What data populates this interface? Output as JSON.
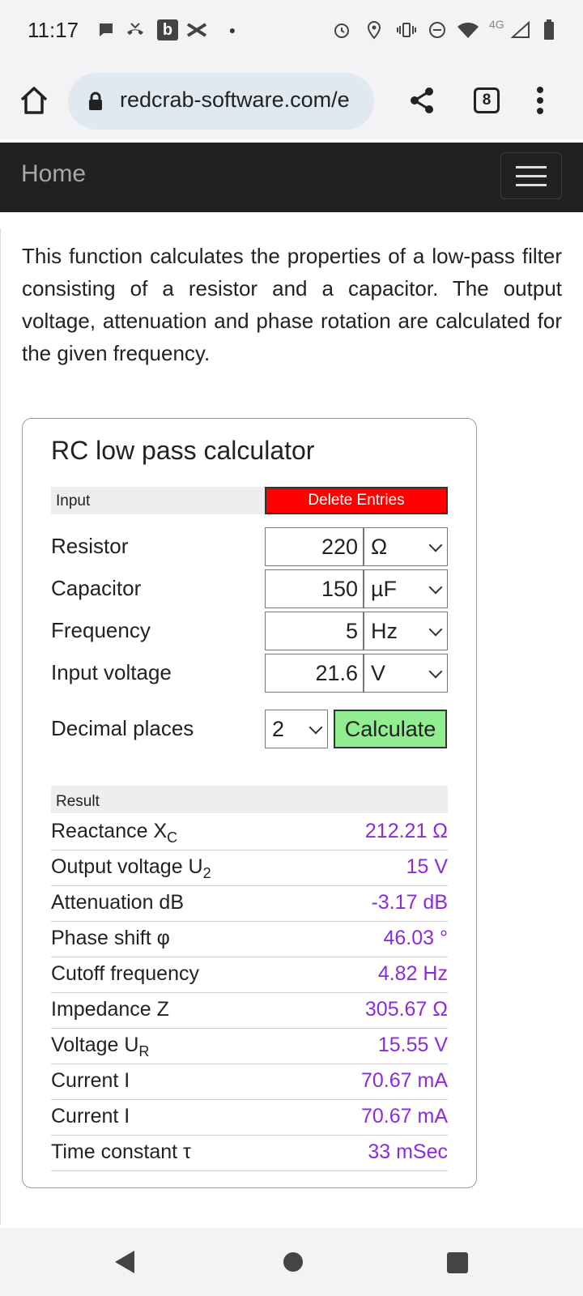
{
  "status_bar": {
    "time": "11:17",
    "network": "4G"
  },
  "browser": {
    "url": "redcrab-software.com/e",
    "tab_count": "8"
  },
  "navbar": {
    "home_label": "Home"
  },
  "intro_text": "This function calculates the properties of a low-pass filter consisting of a resistor and a capacitor. The output voltage, attenuation and phase rotation are calculated for the given frequency.",
  "calculator": {
    "title": "RC low pass calculator",
    "input_header": "Input",
    "delete_label": "Delete Entries",
    "inputs": [
      {
        "label": "Resistor",
        "value": "220",
        "unit": "Ω"
      },
      {
        "label": "Capacitor",
        "value": "150",
        "unit": "µF"
      },
      {
        "label": "Frequency",
        "value": "5",
        "unit": "Hz"
      },
      {
        "label": "Input voltage",
        "value": "21.6",
        "unit": "V"
      }
    ],
    "decimal_label": "Decimal places",
    "decimal_value": "2",
    "calculate_label": "Calculate",
    "result_header": "Result",
    "results": [
      {
        "label": "Reactance X",
        "sub": "C",
        "value": "212.21 Ω"
      },
      {
        "label": "Output voltage U",
        "sub": "2",
        "value": "15 V"
      },
      {
        "label": "Attenuation dB",
        "sub": "",
        "value": "-3.17 dB"
      },
      {
        "label": "Phase shift φ",
        "sub": "",
        "value": "46.03 °"
      },
      {
        "label": "Cutoff frequency",
        "sub": "",
        "value": "4.82 Hz"
      },
      {
        "label": "Impedance Z",
        "sub": "",
        "value": "305.67 Ω"
      },
      {
        "label": "Voltage U",
        "sub": "R",
        "value": "15.55 V"
      },
      {
        "label": "Current I",
        "sub": "",
        "value": "70.67 mA"
      },
      {
        "label": "Current I",
        "sub": "",
        "value": "70.67 mA"
      },
      {
        "label": "Time constant τ",
        "sub": "",
        "value": "33 mSec"
      }
    ]
  },
  "colors": {
    "result_value": "#8a2be2",
    "delete_button": "#ff0000",
    "calculate_button": "#90ee90",
    "navbar": "#212121"
  }
}
